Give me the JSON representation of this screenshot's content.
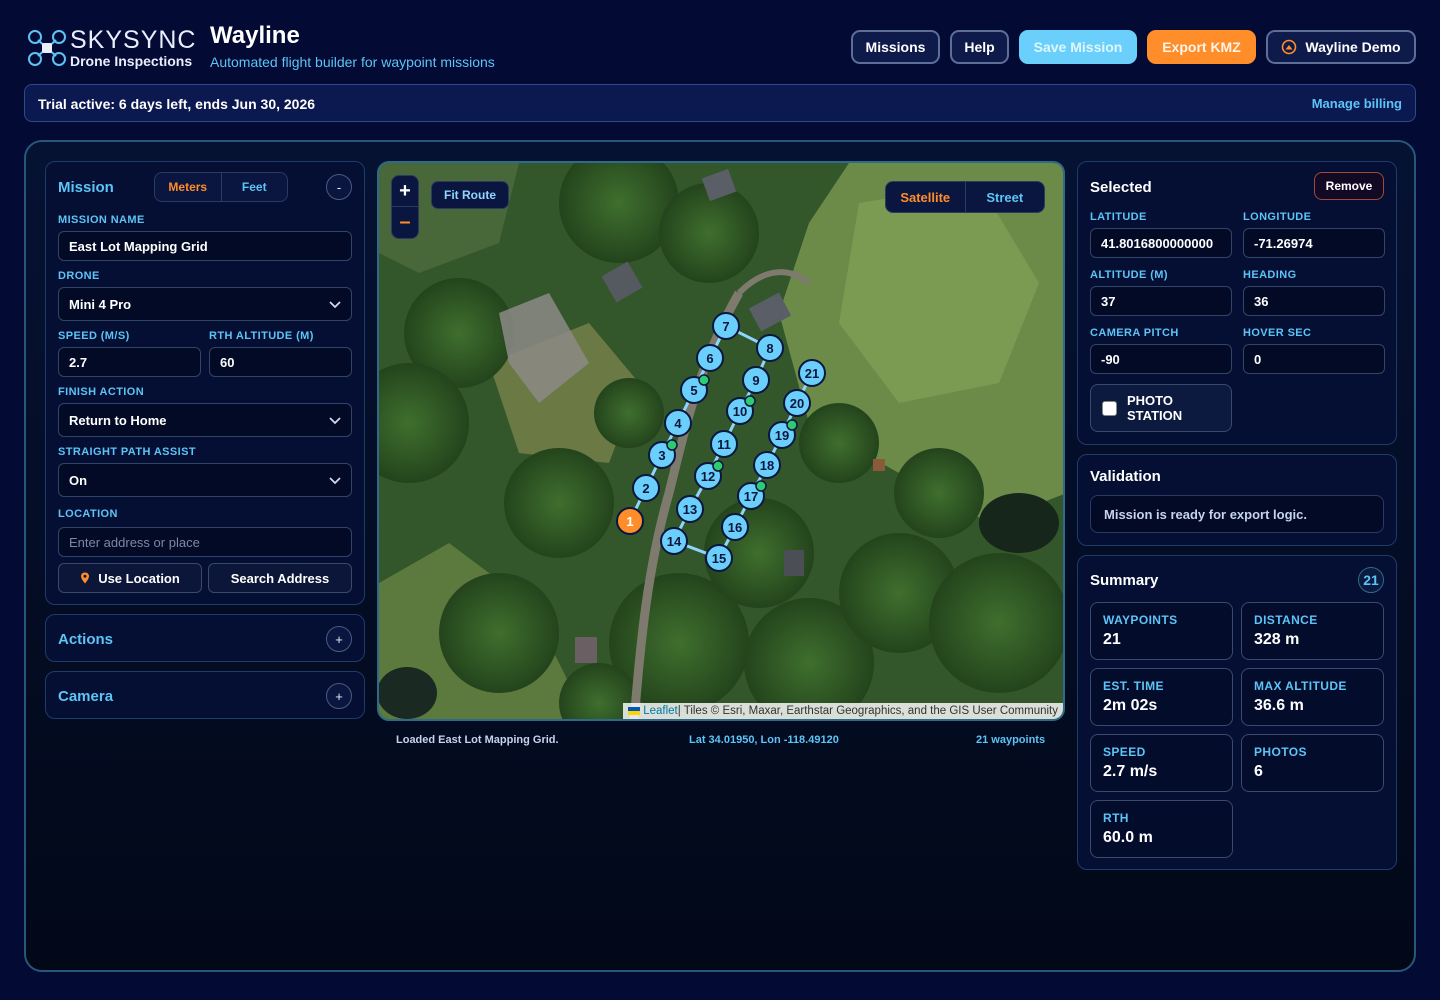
{
  "brand": {
    "name": "SKYSYNC",
    "sub": "Drone Inspections"
  },
  "app": {
    "title": "Wayline",
    "subtitle": "Automated flight builder for waypoint missions"
  },
  "nav": {
    "missions": "Missions",
    "help": "Help",
    "save": "Save Mission",
    "export": "Export KMZ",
    "user": "Wayline Demo"
  },
  "trial": {
    "text": "Trial active: 6 days left, ends Jun 30, 2026",
    "billing": "Manage billing"
  },
  "mission": {
    "title": "Mission",
    "unit_meters": "Meters",
    "unit_feet": "Feet",
    "collapse": "-",
    "name_label": "MISSION NAME",
    "name_value": "East Lot Mapping Grid",
    "drone_label": "DRONE",
    "drone_value": "Mini 4 Pro",
    "speed_label": "SPEED (M/S)",
    "speed_value": "2.7",
    "rth_label": "RTH ALTITUDE (M)",
    "rth_value": "60",
    "finish_label": "FINISH ACTION",
    "finish_value": "Return to Home",
    "straight_label": "STRAIGHT PATH ASSIST",
    "straight_value": "On",
    "location_label": "LOCATION",
    "location_placeholder": "Enter address or place",
    "use_location": "Use Location",
    "search_address": "Search Address"
  },
  "actions": {
    "title": "Actions",
    "expand": "+"
  },
  "camera": {
    "title": "Camera",
    "expand": "+"
  },
  "map": {
    "fit_route": "Fit Route",
    "zoom_in": "+",
    "zoom_out": "–",
    "satellite": "Satellite",
    "street": "Street",
    "attribution_link": "Leaflet",
    "attribution_text": " | Tiles © Esri, Maxar, Earthstar Geographics, and the GIS User Community",
    "status_loaded": "Loaded East Lot Mapping Grid.",
    "status_coords": "Lat 34.01950, Lon -118.49120",
    "status_count": "21 waypoints",
    "waypoints": [
      {
        "label": "1",
        "selected": true,
        "photo": false
      },
      {
        "label": "2",
        "selected": false,
        "photo": false
      },
      {
        "label": "3",
        "selected": false,
        "photo": true
      },
      {
        "label": "4",
        "selected": false,
        "photo": false
      },
      {
        "label": "5",
        "selected": false,
        "photo": true
      },
      {
        "label": "6",
        "selected": false,
        "photo": false
      },
      {
        "label": "7",
        "selected": false,
        "photo": false
      },
      {
        "label": "8",
        "selected": false,
        "photo": false
      },
      {
        "label": "9",
        "selected": false,
        "photo": false
      },
      {
        "label": "10",
        "selected": false,
        "photo": true
      },
      {
        "label": "11",
        "selected": false,
        "photo": false
      },
      {
        "label": "12",
        "selected": false,
        "photo": true
      },
      {
        "label": "13",
        "selected": false,
        "photo": false
      },
      {
        "label": "14",
        "selected": false,
        "photo": false
      },
      {
        "label": "15",
        "selected": false,
        "photo": false
      },
      {
        "label": "16",
        "selected": false,
        "photo": false
      },
      {
        "label": "17",
        "selected": false,
        "photo": true
      },
      {
        "label": "18",
        "selected": false,
        "photo": false
      },
      {
        "label": "19",
        "selected": false,
        "photo": true
      },
      {
        "label": "20",
        "selected": false,
        "photo": false
      },
      {
        "label": "21",
        "selected": false,
        "photo": false
      }
    ]
  },
  "selected": {
    "title": "Selected",
    "remove": "Remove",
    "lat_label": "LATITUDE",
    "lat_value": "41.8016800000000",
    "lon_label": "LONGITUDE",
    "lon_value": "-71.26974",
    "alt_label": "ALTITUDE (M)",
    "alt_value": "37",
    "heading_label": "HEADING",
    "heading_value": "36",
    "pitch_label": "CAMERA PITCH",
    "pitch_value": "-90",
    "hover_label": "HOVER SEC",
    "hover_value": "0",
    "photo_station": "PHOTO STATION"
  },
  "validation": {
    "title": "Validation",
    "message": "Mission is ready for export logic."
  },
  "summary": {
    "title": "Summary",
    "count": "21",
    "stats": [
      {
        "label": "WAYPOINTS",
        "value": "21"
      },
      {
        "label": "DISTANCE",
        "value": "328 m"
      },
      {
        "label": "EST. TIME",
        "value": "2m 02s"
      },
      {
        "label": "MAX ALTITUDE",
        "value": "36.6 m"
      },
      {
        "label": "SPEED",
        "value": "2.7 m/s"
      },
      {
        "label": "PHOTOS",
        "value": "6"
      },
      {
        "label": "RTH",
        "value": "60.0 m"
      }
    ]
  },
  "colors": {
    "accent": "#5cc4f6",
    "orange": "#ff8d2a",
    "bg": "#030a33",
    "waypoint": "#6ad0fb",
    "photo_dot": "#2ecc71"
  }
}
